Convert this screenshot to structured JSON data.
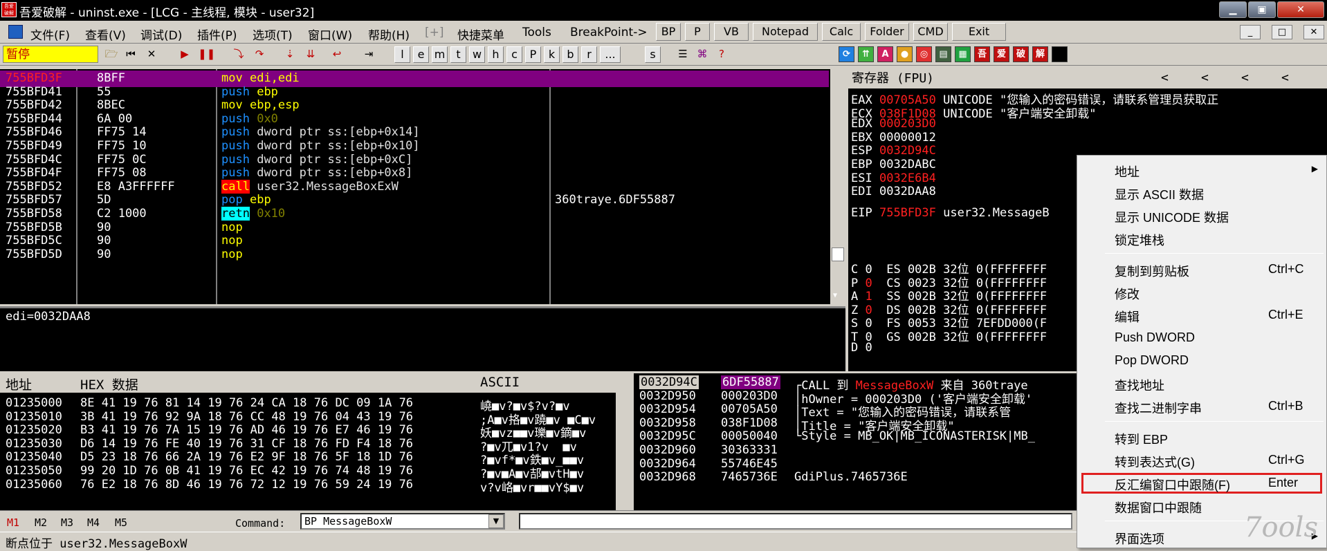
{
  "window": {
    "title": "吾爱破解 - uninst.exe - [LCG - 主线程, 模块 - user32]",
    "app_icon_text": "吾爱破解",
    "minimize": "▁",
    "maximize": "▣",
    "close": "✕"
  },
  "menubar": {
    "items": [
      "文件(F)",
      "查看(V)",
      "调试(D)",
      "插件(P)",
      "选项(T)",
      "窗口(W)",
      "帮助(H)",
      "[+]",
      "快捷菜单",
      "Tools",
      "BreakPoint->"
    ],
    "plugin_buttons": [
      "BP",
      "P",
      "VB",
      "Notepad",
      "Calc",
      "Folder",
      "CMD",
      "Exit"
    ],
    "mdi_buttons": [
      "_",
      "□",
      "✕"
    ]
  },
  "toolbar": {
    "status": "暂停",
    "letter_buttons": [
      "l",
      "e",
      "m",
      "t",
      "w",
      "h",
      "c",
      "P",
      "k",
      "b",
      "r",
      "...",
      "s"
    ],
    "right_icons": [
      "吾",
      "爱",
      "破",
      "解"
    ],
    "colors": {
      "status_bg": "#ffff00",
      "status_fg": "#c00000"
    }
  },
  "disasm": {
    "rows": [
      {
        "addr": "755BFD3F",
        "hex": "8BFF",
        "mnemonic": "mov",
        "operands": "edi,edi",
        "comment": "",
        "selected": true
      },
      {
        "addr": "755BFD41",
        "hex": "55",
        "mnemonic": "push",
        "operands": "ebp",
        "comment": ""
      },
      {
        "addr": "755BFD42",
        "hex": "8BEC",
        "mnemonic": "mov",
        "operands": "ebp,esp",
        "comment": ""
      },
      {
        "addr": "755BFD44",
        "hex": "6A 00",
        "mnemonic": "push",
        "operands": "0x0",
        "comment": ""
      },
      {
        "addr": "755BFD46",
        "hex": "FF75 14",
        "mnemonic": "push",
        "operands": "dword ptr ss:[ebp+0x14]",
        "comment": ""
      },
      {
        "addr": "755BFD49",
        "hex": "FF75 10",
        "mnemonic": "push",
        "operands": "dword ptr ss:[ebp+0x10]",
        "comment": ""
      },
      {
        "addr": "755BFD4C",
        "hex": "FF75 0C",
        "mnemonic": "push",
        "operands": "dword ptr ss:[ebp+0xC]",
        "comment": ""
      },
      {
        "addr": "755BFD4F",
        "hex": "FF75 08",
        "mnemonic": "push",
        "operands": "dword ptr ss:[ebp+0x8]",
        "comment": ""
      },
      {
        "addr": "755BFD52",
        "hex": "E8 A3FFFFFF",
        "mnemonic": "call",
        "operands": "user32.MessageBoxExW",
        "comment": ""
      },
      {
        "addr": "755BFD57",
        "hex": "5D",
        "mnemonic": "pop",
        "operands": "ebp",
        "comment": "360traye.6DF55887"
      },
      {
        "addr": "755BFD58",
        "hex": "C2 1000",
        "mnemonic": "retn",
        "operands": "0x10",
        "comment": ""
      },
      {
        "addr": "755BFD5B",
        "hex": "90",
        "mnemonic": "nop",
        "operands": "",
        "comment": ""
      },
      {
        "addr": "755BFD5C",
        "hex": "90",
        "mnemonic": "nop",
        "operands": "",
        "comment": ""
      },
      {
        "addr": "755BFD5D",
        "hex": "90",
        "mnemonic": "nop",
        "operands": "",
        "comment": ""
      }
    ],
    "info": "edi=0032DAA8"
  },
  "registers": {
    "title": "寄存器 (FPU)",
    "arrows": [
      "<",
      "<",
      "<",
      "<"
    ],
    "rows": [
      {
        "name": "EAX",
        "value": "00705A50",
        "changed": true,
        "note": "UNICODE \"您输入的密码错误，请联系管理员获取正"
      },
      {
        "name": "ECX",
        "value": "038F1D08",
        "changed": true,
        "note": "UNICODE \"客户端安全卸载\""
      },
      {
        "name": "EDX",
        "value": "000203D0",
        "changed": true,
        "note": ""
      },
      {
        "name": "EBX",
        "value": "00000012",
        "changed": false,
        "note": ""
      },
      {
        "name": "ESP",
        "value": "0032D94C",
        "changed": true,
        "note": ""
      },
      {
        "name": "EBP",
        "value": "0032DABC",
        "changed": false,
        "note": ""
      },
      {
        "name": "ESI",
        "value": "0032E6B4",
        "changed": true,
        "note": ""
      },
      {
        "name": "EDI",
        "value": "0032DAA8",
        "changed": false,
        "note": ""
      },
      {
        "name": "EIP",
        "value": "755BFD3F",
        "changed": true,
        "note": "user32.MessageB"
      }
    ],
    "flags": [
      {
        "f": "C",
        "v": "0",
        "changed": false,
        "seg": "ES 002B 32位 0(FFFFFFFF"
      },
      {
        "f": "P",
        "v": "0",
        "changed": true,
        "seg": "CS 0023 32位 0(FFFFFFFF"
      },
      {
        "f": "A",
        "v": "1",
        "changed": true,
        "seg": "SS 002B 32位 0(FFFFFFFF"
      },
      {
        "f": "Z",
        "v": "0",
        "changed": true,
        "seg": "DS 002B 32位 0(FFFFFFFF"
      },
      {
        "f": "S",
        "v": "0",
        "changed": false,
        "seg": "FS 0053 32位 7EFDD000(F"
      },
      {
        "f": "T",
        "v": "0",
        "changed": false,
        "seg": "GS 002B 32位 0(FFFFFFFF"
      },
      {
        "f": "D",
        "v": "0",
        "changed": false,
        "seg": ""
      }
    ]
  },
  "dump": {
    "col_addr": "地址",
    "col_hex": "HEX 数据",
    "col_ascii": "ASCII",
    "rows": [
      {
        "addr": "01235000",
        "hex": "8E 41 19 76 81 14 19 76 24 CA 18 76 DC 09 1A 76",
        "ascii": "嶢■v?■v$?v?■v"
      },
      {
        "addr": "01235010",
        "hex": "3B 41 19 76 92 9A 18 76 CC 48 19 76 04 43 19 76",
        "ascii": ";A■v挌■v蹺■v ■C■v"
      },
      {
        "addr": "01235020",
        "hex": "B3 41 19 76 7A 15 19 76 AD 46 19 76 E7 46 19 76",
        "ascii": "妖■vz■■v瓅■v鏑■v"
      },
      {
        "addr": "01235030",
        "hex": "D6 14 19 76 FE 40 19 76 31 CF 18 76 FD F4 18 76",
        "ascii": "?■v兀■v1?v  ■v"
      },
      {
        "addr": "01235040",
        "hex": "D5 23 18 76 66 2A 19 76 E2 9F 18 76 5F 18 1D 76",
        "ascii": "?■vf*■v鉄■v_■■v"
      },
      {
        "addr": "01235050",
        "hex": "99 20 1D 76 0B 41 19 76 EC 42 19 76 74 48 19 76",
        "ascii": "?■v■A■v郆■vtH■v"
      },
      {
        "addr": "01235060",
        "hex": "76 E2 18 76 8D 46 19 76 72 12 19 76 59 24 19 76",
        "ascii": "v?v峈■vr■■vY$■v"
      }
    ]
  },
  "stack": {
    "rows": [
      {
        "addr": "0032D94C",
        "value": "6DF55887",
        "comment": "┌CALL 到 MessageBoxW 来自 360traye",
        "selected": true
      },
      {
        "addr": "0032D950",
        "value": "000203D0",
        "comment": "│hOwner = 000203D0 ('客户端安全卸载'"
      },
      {
        "addr": "0032D954",
        "value": "00705A50",
        "comment": "│Text = \"您输入的密码错误，请联系管"
      },
      {
        "addr": "0032D958",
        "value": "038F1D08",
        "comment": "│Title = \"客户端安全卸载\""
      },
      {
        "addr": "0032D95C",
        "value": "00050040",
        "comment": "└Style = MB_OK|MB_ICONASTERISK|MB_"
      },
      {
        "addr": "0032D960",
        "value": "30363331",
        "comment": ""
      },
      {
        "addr": "0032D964",
        "value": "55746E45",
        "comment": ""
      },
      {
        "addr": "0032D968",
        "value": "7465736E",
        "comment": "GdiPlus.7465736E"
      }
    ]
  },
  "commandbar": {
    "marks": [
      "M1",
      "M2",
      "M3",
      "M4",
      "M5"
    ],
    "label": "Command:",
    "value": "BP MessageBoxW",
    "dropdown": "▼"
  },
  "statusbar": {
    "text": "断点位于 user32.MessageBoxW"
  },
  "context_menu": {
    "items": [
      {
        "label": "地址",
        "shortcut": "",
        "submenu": true
      },
      {
        "label": "显示 ASCII 数据",
        "shortcut": ""
      },
      {
        "label": "显示 UNICODE 数据",
        "shortcut": ""
      },
      {
        "label": "锁定堆栈",
        "shortcut": ""
      },
      {
        "label": "复制到剪贴板",
        "shortcut": "Ctrl+C"
      },
      {
        "label": "修改",
        "shortcut": ""
      },
      {
        "label": "编辑",
        "shortcut": "Ctrl+E"
      },
      {
        "label": "Push DWORD",
        "shortcut": ""
      },
      {
        "label": "Pop DWORD",
        "shortcut": ""
      },
      {
        "label": "查找地址",
        "shortcut": ""
      },
      {
        "label": "查找二进制字串",
        "shortcut": "Ctrl+B"
      },
      {
        "label": "转到 EBP",
        "shortcut": ""
      },
      {
        "label": "转到表达式(G)",
        "shortcut": "Ctrl+G"
      },
      {
        "label": "反汇编窗口中跟随(F)",
        "shortcut": "Enter",
        "highlighted": true
      },
      {
        "label": "数据窗口中跟随",
        "shortcut": ""
      },
      {
        "label": "界面选项",
        "shortcut": "",
        "submenu": true
      }
    ],
    "watermark": "7ools",
    "highlight_color": "#e02020"
  }
}
